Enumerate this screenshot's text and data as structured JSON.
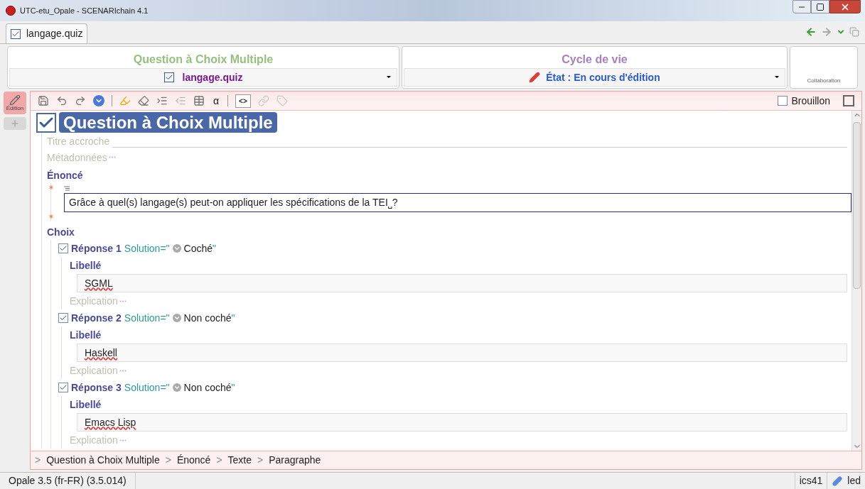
{
  "window": {
    "title": "UTC-etu_Opale - SCENARIchain 4.1"
  },
  "tab": {
    "label": "langage.quiz",
    "selected": true
  },
  "header": {
    "model_title": "Question à Choix Multiple",
    "item": "langage.quiz",
    "lifecycle_title": "Cycle de vie",
    "state": "État : En cours d'édition",
    "collaboration": "Collaboration"
  },
  "side_tabs": [
    {
      "kind": "edit",
      "label": "Édition",
      "selected": true
    },
    {
      "kind": "add",
      "selected": false
    }
  ],
  "toolbar": {
    "symbol": "α",
    "xml_view": "<>",
    "draft": {
      "label": "Brouillon",
      "checked": false
    }
  },
  "document": {
    "title": "Question à Choix Multiple",
    "checked": true,
    "fields": [
      {
        "label": "Titre accroche",
        "kind": "line"
      },
      {
        "label": "Métadonnées",
        "kind": "more"
      }
    ],
    "statement": {
      "label": "Énoncé",
      "text": "Grâce à quel(s) langage(s) peut-on appliquer les spécifications de la TEI⎵?"
    },
    "choices_label": "Choix",
    "answers": [
      {
        "title": "Réponse 1",
        "checked": true,
        "attr": "Solution=\"",
        "value": "Coché",
        "close": "\"",
        "label_heading": "Libellé",
        "text": "SGML",
        "misspelled": true,
        "explanation": "Explication"
      },
      {
        "title": "Réponse 2",
        "checked": true,
        "attr": "Solution=\"",
        "value": "Non coché",
        "close": "\"",
        "label_heading": "Libellé",
        "text": "Haskell",
        "misspelled": true,
        "explanation": "Explication"
      },
      {
        "title": "Réponse 3",
        "checked": true,
        "attr": "Solution=\"",
        "value": "Non coché",
        "close": "\"",
        "label_heading": "Libellé",
        "text": "Emacs Lisp",
        "misspelled": true,
        "explanation": "Explication"
      }
    ]
  },
  "breadcrumb": {
    "separator": ">",
    "items": [
      "Question à Choix Multiple",
      "Énoncé",
      "Texte",
      "Paragraphe"
    ]
  },
  "status_bar": {
    "version": "Opale 3.5 (fr-FR) (3.5.014)",
    "user": "ics41",
    "server": "led"
  }
}
